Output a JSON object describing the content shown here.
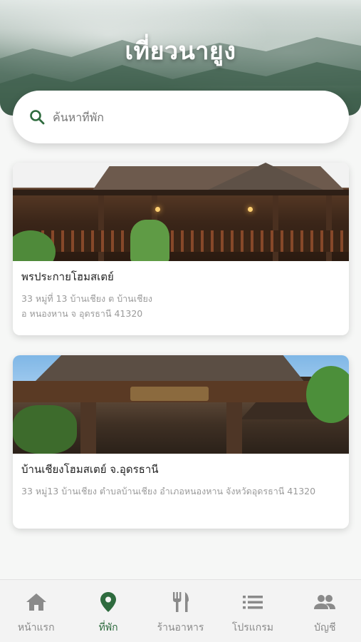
{
  "header": {
    "title": "เที่ยวนายูง"
  },
  "search": {
    "placeholder": "ค้นหาที่พัก",
    "value": ""
  },
  "listings": [
    {
      "name": "พรประกายโฮมสเตย์",
      "address_line1": "33 หมู่ที่ 13 บ้านเชียง ต บ้านเชียง",
      "address_line2": "อ หนองหาน จ อุดรธานี 41320"
    },
    {
      "name": "บ้านเชียงโฮมสเตย์ จ.อุดรธานี",
      "address_line1": "33 หมู่13 บ้านเชียง ตำบลบ้านเชียง อำเภอหนองหาน  จังหวัดอุดรธานี 41320",
      "address_line2": ""
    }
  ],
  "tabs": [
    {
      "label": "หน้าแรก",
      "icon": "home-icon",
      "active": false
    },
    {
      "label": "ที่พัก",
      "icon": "location-pin-icon",
      "active": true
    },
    {
      "label": "ร้านอาหาร",
      "icon": "fork-knife-icon",
      "active": false
    },
    {
      "label": "โปรแกรม",
      "icon": "list-icon",
      "active": false
    },
    {
      "label": "บัญชี",
      "icon": "people-icon",
      "active": false
    }
  ],
  "colors": {
    "accent": "#2e6b3e",
    "inactive": "#8a8a8a"
  }
}
